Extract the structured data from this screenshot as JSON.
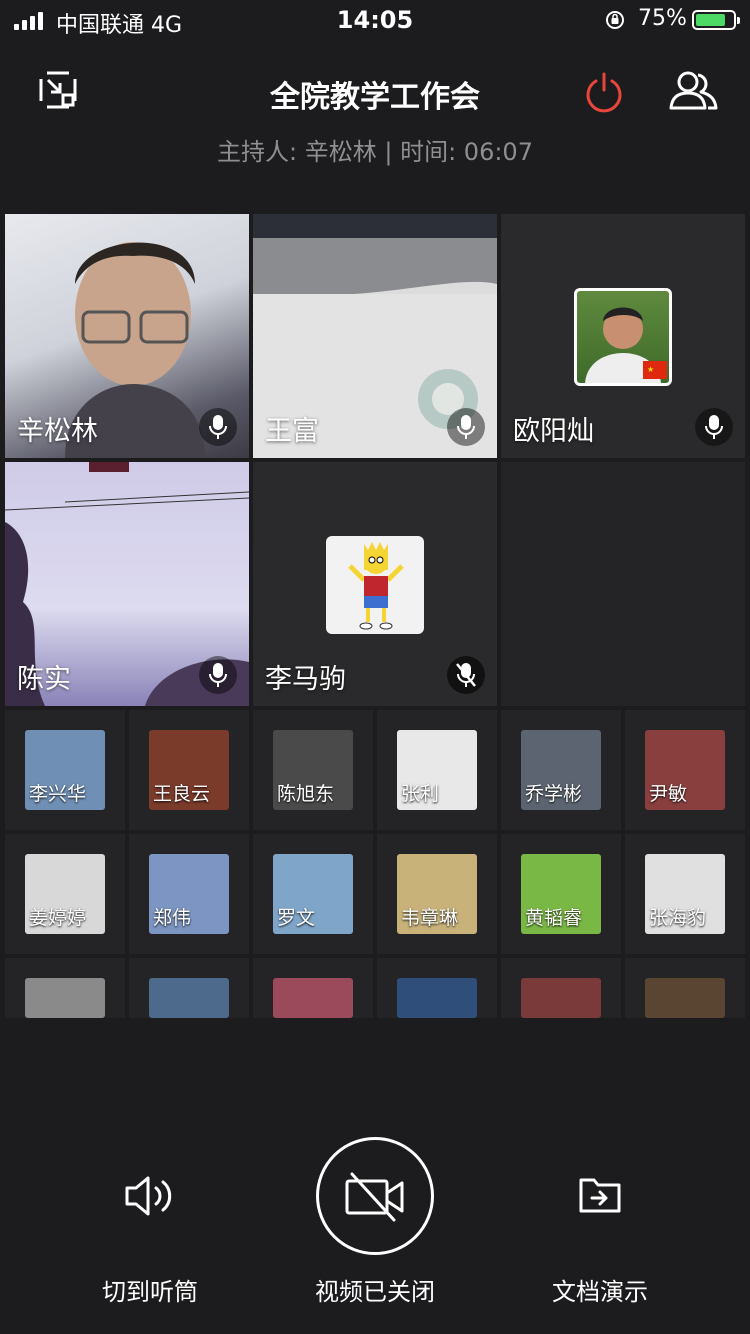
{
  "status_bar": {
    "carrier": "中国联通  4G",
    "time": "14:05",
    "battery": "75%",
    "battery_level": 0.75
  },
  "header": {
    "title": "全院教学工作会",
    "subtitle": "主持人: 辛松林 | 时间: 06:07"
  },
  "video_tiles": [
    {
      "name": "辛松林",
      "mic": "on",
      "kind": "camera"
    },
    {
      "name": "王富",
      "mic": "on",
      "kind": "camera"
    },
    {
      "name": "欧阳灿",
      "mic": "on",
      "kind": "avatar"
    },
    {
      "name": "陈实",
      "mic": "on",
      "kind": "camera"
    },
    {
      "name": "李马驹",
      "mic": "muted",
      "kind": "avatar"
    }
  ],
  "participants": [
    {
      "name": "李兴华"
    },
    {
      "name": "王良云"
    },
    {
      "name": "陈旭东"
    },
    {
      "name": "张利"
    },
    {
      "name": "乔学彬"
    },
    {
      "name": "尹敏"
    },
    {
      "name": "姜婷婷"
    },
    {
      "name": "郑伟"
    },
    {
      "name": "罗文"
    },
    {
      "name": "韦章琳"
    },
    {
      "name": "黄韬睿"
    },
    {
      "name": "张海豹"
    }
  ],
  "controls": {
    "speaker_label": "切到听筒",
    "video_label": "视频已关闭",
    "doc_label": "文档演示"
  },
  "colors": {
    "background": "#1c1c1e",
    "hangup": "#e8463a",
    "battery_fill": "#4cd964",
    "secondary_text": "#8e8e93"
  }
}
